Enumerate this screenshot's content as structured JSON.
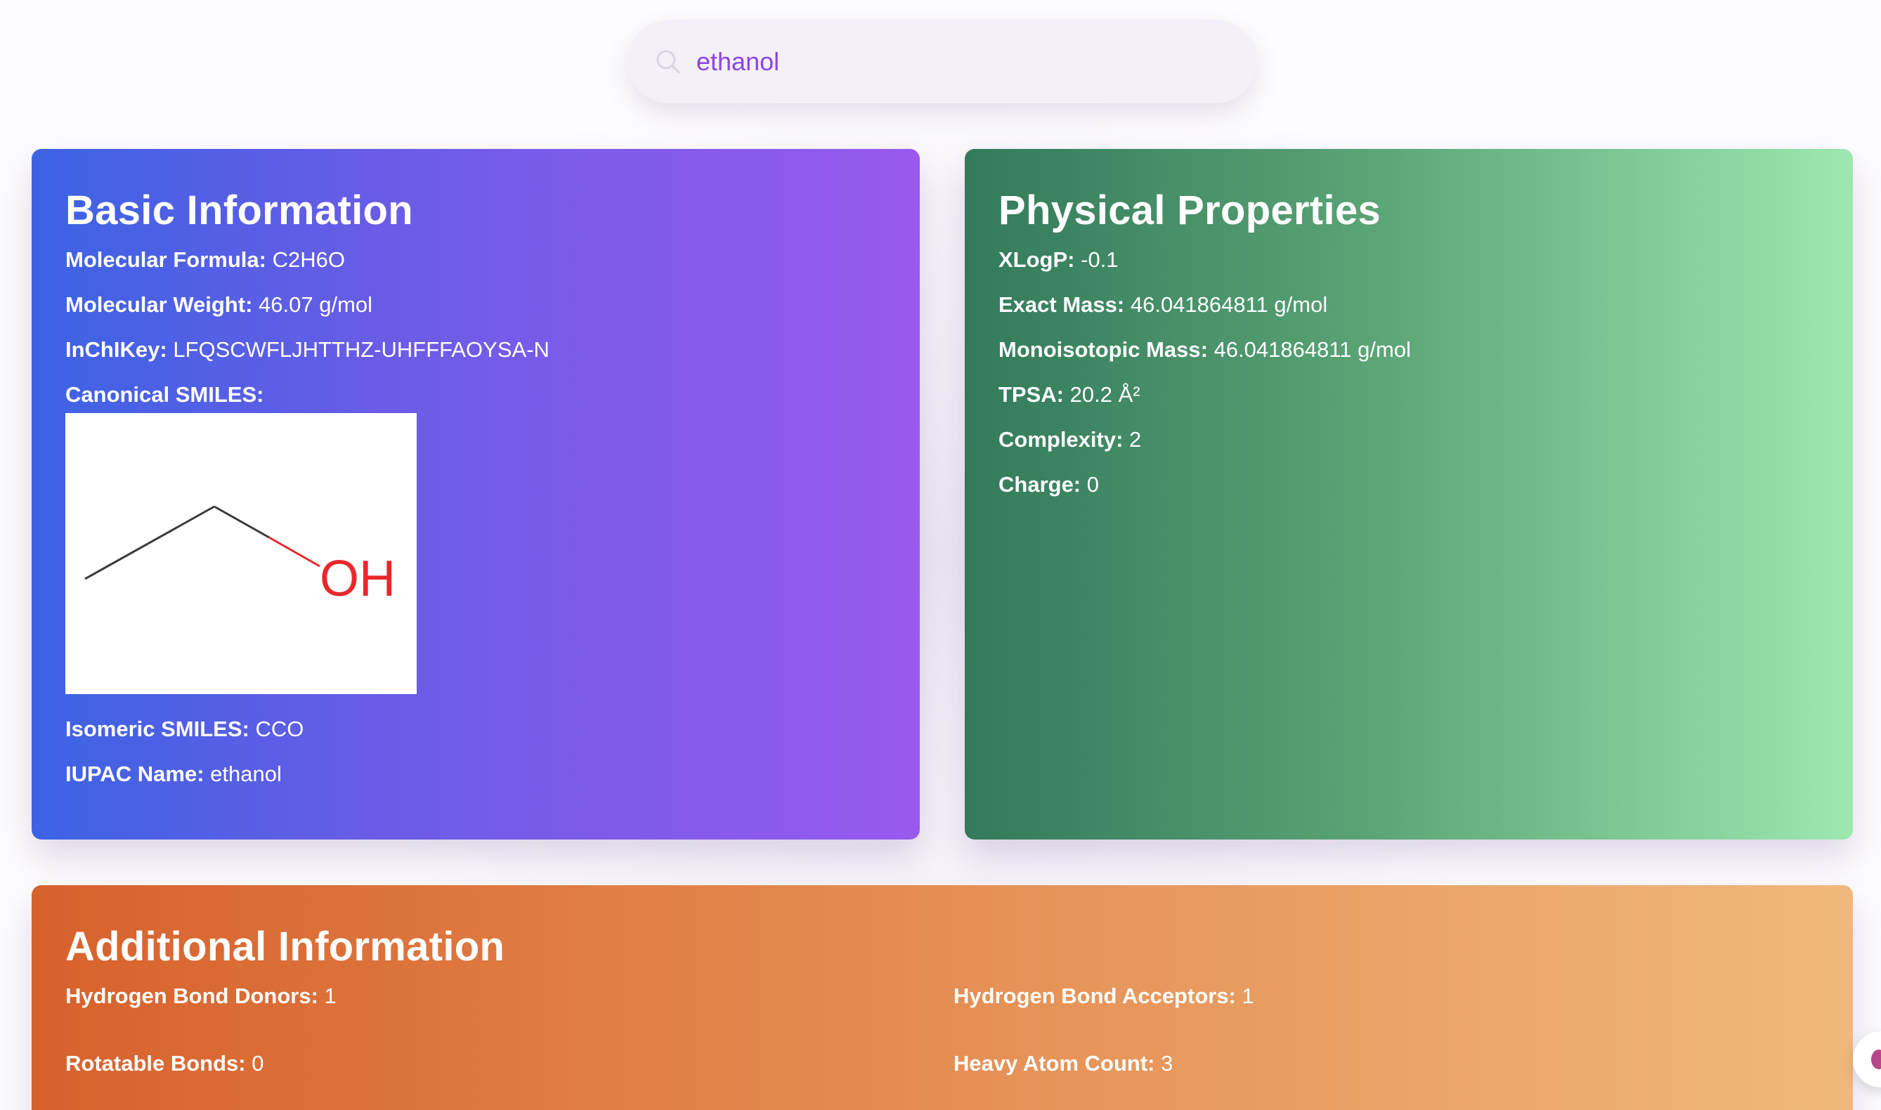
{
  "search": {
    "value": "ethanol",
    "icon": "search-icon"
  },
  "basic": {
    "title": "Basic Information",
    "formula_label": "Molecular Formula:",
    "formula_value": "C2H6O",
    "weight_label": "Molecular Weight:",
    "weight_value": "46.07 g/mol",
    "inchikey_label": "InChIKey:",
    "inchikey_value": "LFQSCWFLJHTTHZ-UHFFFAOYSA-N",
    "canonical_label": "Canonical SMILES:",
    "structure_atom_label": "OH",
    "isomeric_label": "Isomeric SMILES:",
    "isomeric_value": "CCO",
    "iupac_label": "IUPAC Name:",
    "iupac_value": "ethanol"
  },
  "physical": {
    "title": "Physical Properties",
    "xlogp_label": "XLogP:",
    "xlogp_value": "-0.1",
    "exact_mass_label": "Exact Mass:",
    "exact_mass_value": "46.041864811 g/mol",
    "mono_mass_label": "Monoisotopic Mass:",
    "mono_mass_value": "46.041864811 g/mol",
    "tpsa_label": "TPSA:",
    "tpsa_value": "20.2 Å²",
    "complexity_label": "Complexity:",
    "complexity_value": "2",
    "charge_label": "Charge:",
    "charge_value": "0"
  },
  "additional": {
    "title": "Additional Information",
    "hbd_label": "Hydrogen Bond Donors:",
    "hbd_value": "1",
    "hba_label": "Hydrogen Bond Acceptors:",
    "hba_value": "1",
    "rot_label": "Rotatable Bonds:",
    "rot_value": "0",
    "heavy_label": "Heavy Atom Count:",
    "heavy_value": "3"
  },
  "colors": {
    "basic_gradient": [
      "#3c63e4",
      "#995aed"
    ],
    "physical_gradient": [
      "#327a5a",
      "#9de8b0"
    ],
    "additional_gradient": [
      "#d7612c",
      "#f0b87c"
    ],
    "search_text": "#8b44e8",
    "oxygen_label": "#e8282b"
  }
}
